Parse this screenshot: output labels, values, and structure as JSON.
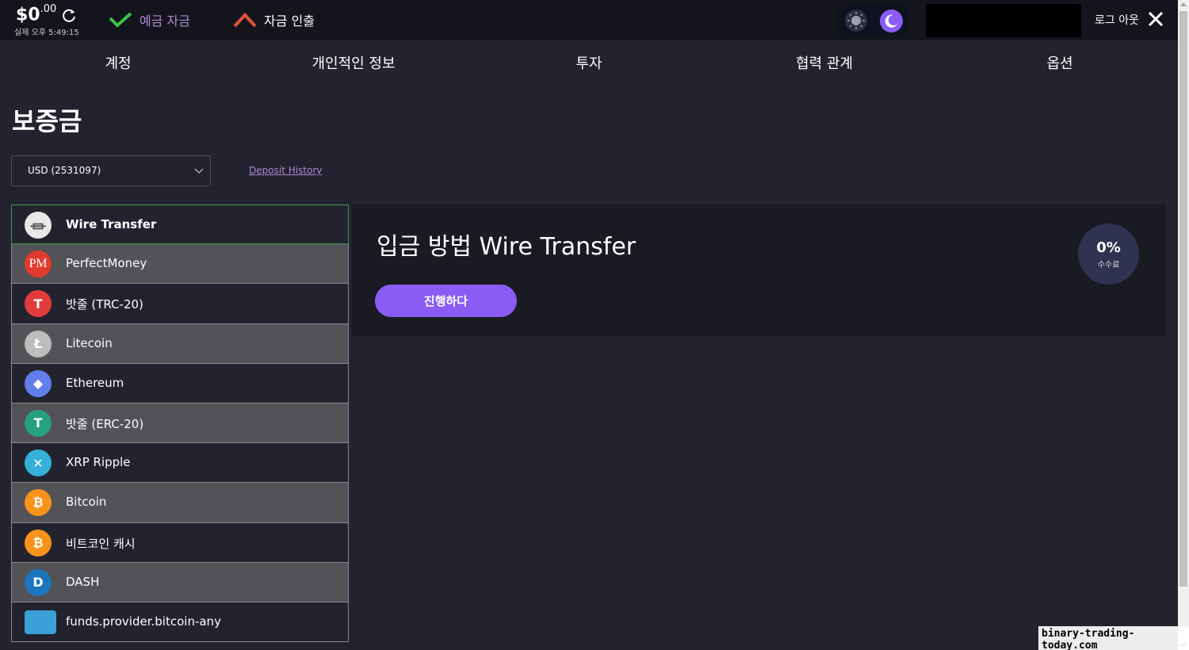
{
  "header": {
    "balance_main": "$0",
    "balance_cents": ".00",
    "clock": "실제 오후 5:49:15",
    "deposit_label": "예금 자금",
    "withdraw_label": "자금 인출",
    "logout_label": "로그 아웃"
  },
  "nav": {
    "items": [
      "계정",
      "개인적인 정보",
      "투자",
      "협력 관계",
      "옵션"
    ]
  },
  "page": {
    "title": "보증금",
    "currency_value": "USD (2531097)",
    "history_link": "Deposit History"
  },
  "methods": [
    {
      "name": "Wire Transfer",
      "icon": "bank-icon",
      "color": "#e8e8e8",
      "glyph": "⏛"
    },
    {
      "name": "PerfectMoney",
      "icon": "perfectmoney-icon",
      "color": "#e23b2e",
      "glyph": "PM"
    },
    {
      "name": "밧줄 (TRC-20)",
      "icon": "tether-trc20-icon",
      "color": "#e03c3c",
      "glyph": "T"
    },
    {
      "name": "Litecoin",
      "icon": "litecoin-icon",
      "color": "#bdbdbd",
      "glyph": "Ł"
    },
    {
      "name": "Ethereum",
      "icon": "ethereum-icon",
      "color": "#627eea",
      "glyph": "◆"
    },
    {
      "name": "밧줄 (ERC-20)",
      "icon": "tether-erc20-icon",
      "color": "#26a17b",
      "glyph": "T"
    },
    {
      "name": "XRP Ripple",
      "icon": "xrp-icon",
      "color": "#34b1d8",
      "glyph": "✕"
    },
    {
      "name": "Bitcoin",
      "icon": "bitcoin-icon",
      "color": "#f7931a",
      "glyph": "₿"
    },
    {
      "name": "비트코인 캐시",
      "icon": "bitcoin-cash-icon",
      "color": "#f7931a",
      "glyph": "₿"
    },
    {
      "name": "DASH",
      "icon": "dash-icon",
      "color": "#1c75bc",
      "glyph": "D"
    },
    {
      "name": "funds.provider.bitcoin-any",
      "icon": "credit-card-icon",
      "color": "#3aa0d8",
      "glyph": "▭"
    }
  ],
  "panel": {
    "title": "입금 방법 Wire Transfer",
    "proceed_label": "진행하다",
    "fee_value": "0%",
    "fee_label": "수수료"
  },
  "watermark": "binary-trading-today.com",
  "colors": {
    "accent": "#8a5cf5",
    "deposit_green": "#3fbf4a",
    "withdraw_red": "#e0543a",
    "selected_border": "#3f9a4a"
  }
}
